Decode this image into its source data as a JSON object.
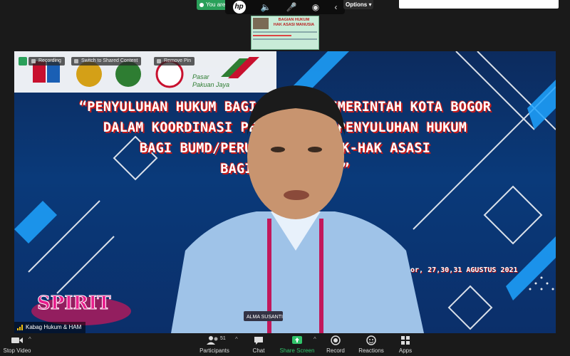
{
  "top": {
    "recording_label": "You are",
    "options_label": "Options"
  },
  "thumbnail": {
    "title_line1": "BAGIAN HUKUM",
    "title_line2": "HAK ASASI MANUSIA"
  },
  "stage": {
    "overlay_recording": "Recording",
    "overlay_switch": "Switch to Shared Content",
    "overlay_pin": "Remove Pin",
    "company_name_1": "Pasar",
    "company_name_2": "Pakuan Jaya",
    "banner_lines": [
      "“PENYULUHAN HUKUM BAGI A        NGAN PEMERINTAH KOTA BOGOR",
      "DALAM KOORDINASI PENY        RA DAN PENYULUHAN HUKUM",
      "BAGI BUMD/PERUSAH        UHAN HAK-HAK ASASI",
      "BAGI PE        PANDEMI”"
    ],
    "date_text": "or, 27,30,31 AGUSTUS 2021",
    "name_badge": "ALMA SUSANTI",
    "participant_name": "Kabag Hukum & HAM"
  },
  "toolbar": {
    "stop_video": "Stop Video",
    "participants": "Participants",
    "participants_count": "51",
    "chat": "Chat",
    "share_screen": "Share Screen",
    "record": "Record",
    "reactions": "Reactions",
    "apps": "Apps"
  },
  "colors": {
    "accent_green": "#31c46a",
    "banner_red": "#c51b1b",
    "stage_blue": "#0a3a7a"
  }
}
